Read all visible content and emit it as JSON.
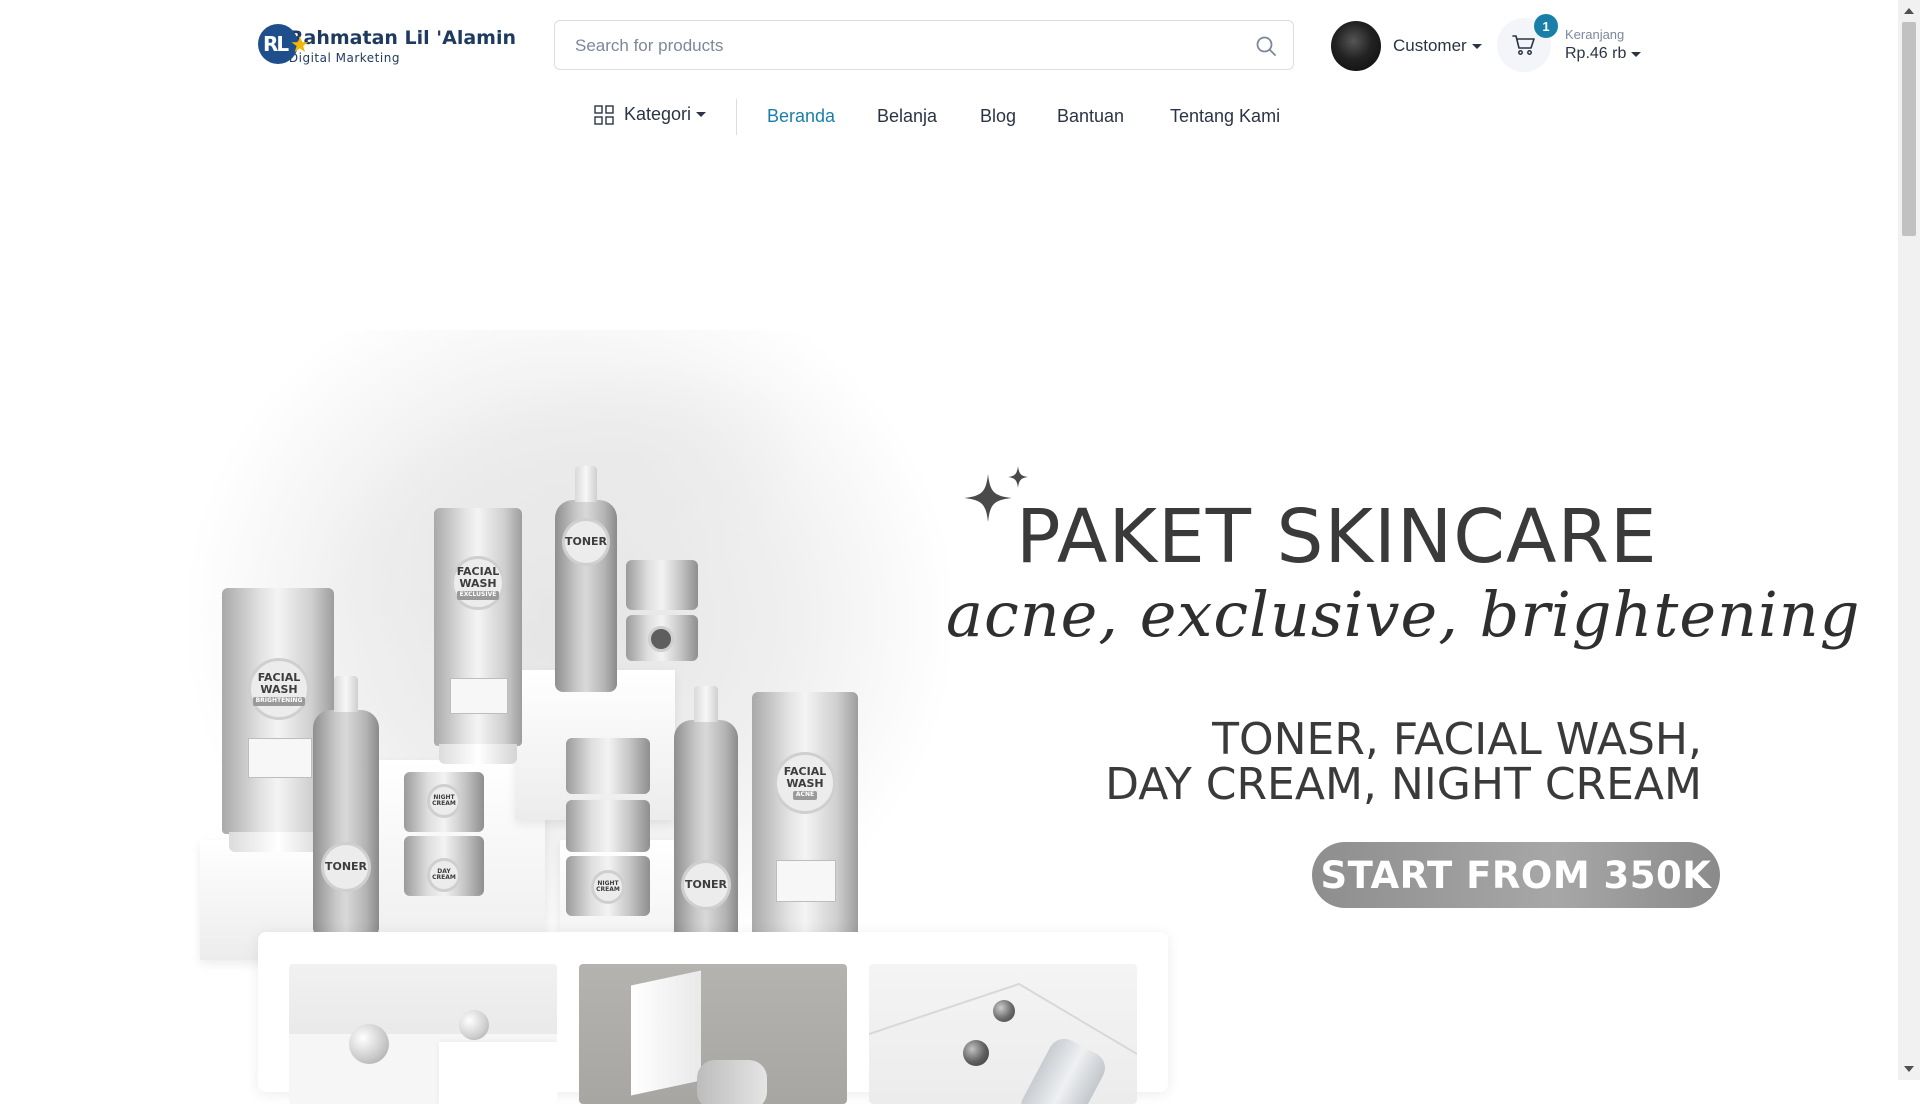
{
  "brand": {
    "logo_letters": "RL",
    "name": "Rahmatan Lil 'Alamin",
    "tagline": "Digital Marketing"
  },
  "search": {
    "placeholder": "Search for products"
  },
  "account": {
    "label": "Customer"
  },
  "cart": {
    "count": "1",
    "label": "Keranjang",
    "total": "Rp.46 rb"
  },
  "nav": {
    "category_label": "Kategori",
    "items": [
      {
        "label": "Beranda",
        "active": true
      },
      {
        "label": "Belanja",
        "active": false
      },
      {
        "label": "Blog",
        "active": false
      },
      {
        "label": "Bantuan",
        "active": false
      },
      {
        "label": "Tentang Kami",
        "active": false
      }
    ]
  },
  "hero": {
    "title": "PAKET SKINCARE",
    "script": "acne, exclusive, brightening",
    "line1": "TONER, FACIAL WASH,",
    "line2": "DAY CREAM, NIGHT CREAM",
    "cta": "START FROM 350K",
    "product_labels": {
      "facial_wash": "FACIAL WASH",
      "toner": "TONER",
      "night_cream": "NIGHT CREAM",
      "day_cream": "DAY CREAM",
      "brightening": "BRIGHTENING",
      "acne": "ACNE",
      "exclusive": "EXCLUSIVE"
    }
  },
  "icons": {
    "search": "search-icon",
    "cart": "cart-icon",
    "category": "grid-icon",
    "caret": "caret-down-icon",
    "sparkle": "sparkle-icon"
  },
  "colors": {
    "accent": "#1a7fa8",
    "text": "#2b3445",
    "muted": "#7d879c",
    "cta_bg": "#9a9a9a"
  }
}
